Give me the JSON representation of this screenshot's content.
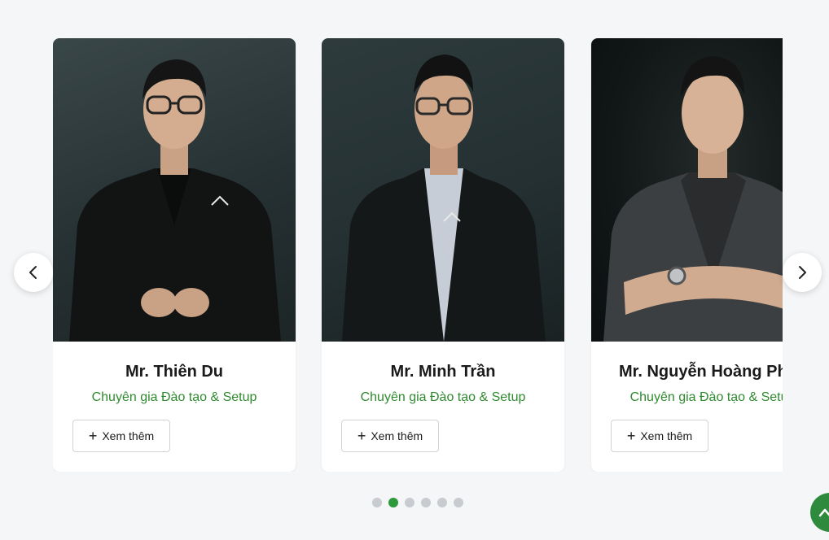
{
  "carousel": {
    "prev_icon": "chevron-left-icon",
    "next_icon": "chevron-right-icon",
    "cards": [
      {
        "name": "Mr. Thiên Du",
        "role": "Chuyên gia Đào tạo & Setup",
        "button_label": "Xem thêm"
      },
      {
        "name": "Mr. Minh Trần",
        "role": "Chuyên gia Đào tạo & Setup",
        "button_label": "Xem thêm"
      },
      {
        "name": "Mr. Nguyễn Hoàng Phúc",
        "role": "Chuyên gia Đào tạo & Setup",
        "button_label": "Xem thêm"
      }
    ],
    "pagination": {
      "count": 6,
      "active_index": 1
    }
  },
  "scroll_top": {
    "icon": "chevron-up-icon"
  },
  "colors": {
    "accent": "#2c9a3a",
    "role_text": "#2f8a2f",
    "page_background": "#f5f6f8",
    "dot_inactive": "#c8ccd0"
  }
}
